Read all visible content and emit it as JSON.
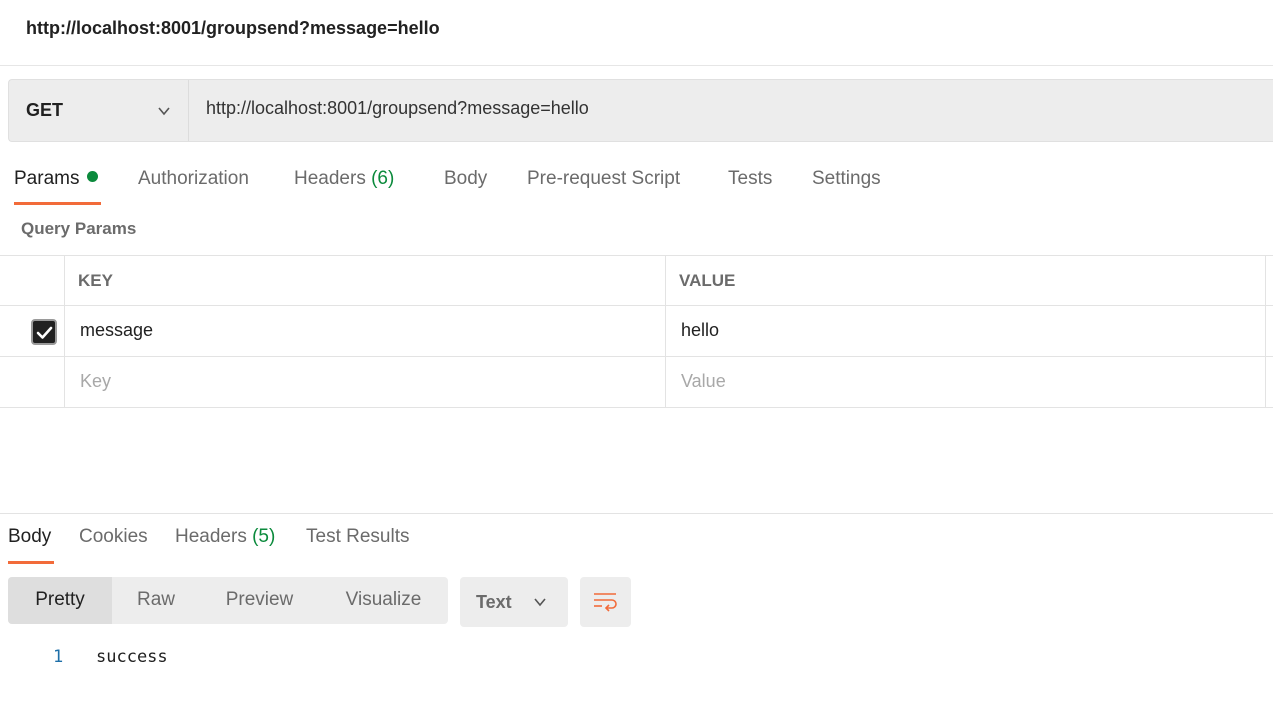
{
  "header": {
    "title": "http://localhost:8001/groupsend?message=hello"
  },
  "request": {
    "method": "GET",
    "url": "http://localhost:8001/groupsend?message=hello"
  },
  "request_tabs": {
    "params": "Params",
    "authorization": "Authorization",
    "headers": "Headers",
    "headers_count": "(6)",
    "body": "Body",
    "pre_request_script": "Pre-request Script",
    "tests": "Tests",
    "settings": "Settings"
  },
  "query_params": {
    "label": "Query Params",
    "key_header": "KEY",
    "value_header": "VALUE",
    "rows": [
      {
        "enabled": true,
        "key": "message",
        "value": "hello"
      }
    ],
    "key_placeholder": "Key",
    "value_placeholder": "Value"
  },
  "response_tabs": {
    "body": "Body",
    "cookies": "Cookies",
    "headers": "Headers",
    "headers_count": "(5)",
    "test_results": "Test Results"
  },
  "view_modes": {
    "pretty": "Pretty",
    "raw": "Raw",
    "preview": "Preview",
    "visualize": "Visualize",
    "selected": "Pretty"
  },
  "format": {
    "selected": "Text"
  },
  "response_body": {
    "lines": [
      {
        "number": "1",
        "text": "success"
      }
    ]
  },
  "colors": {
    "accent": "#f26b3a",
    "success_green": "#0b8a3c",
    "line_number_blue": "#1e6fa8"
  },
  "icons": {
    "method_dropdown": "chevron-down-icon",
    "checkbox": "check-icon",
    "format_dropdown": "chevron-down-icon",
    "wrap": "wrap-lines-icon"
  }
}
